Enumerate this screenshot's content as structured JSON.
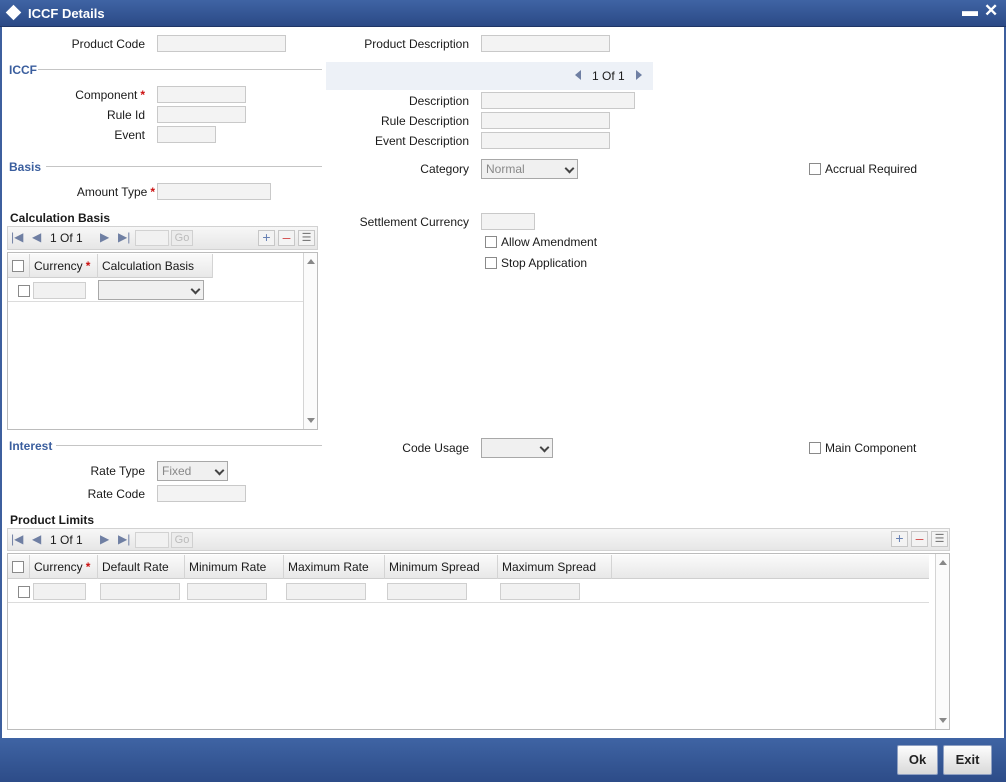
{
  "window": {
    "title": "ICCF Details"
  },
  "header": {
    "product_code_label": "Product Code",
    "product_description_label": "Product Description"
  },
  "iccf": {
    "section_title": "ICCF",
    "component_label": "Component",
    "rule_id_label": "Rule Id",
    "event_label": "Event",
    "pager": {
      "current": "1",
      "of_label": "Of",
      "total": "1"
    },
    "description_label": "Description",
    "rule_description_label": "Rule Description",
    "event_description_label": "Event Description"
  },
  "basis": {
    "section_title": "Basis",
    "amount_type_label": "Amount Type",
    "category_label": "Category",
    "category_value": "Normal",
    "accrual_required_label": "Accrual Required",
    "settlement_currency_label": "Settlement Currency",
    "allow_amendment_label": "Allow Amendment",
    "stop_application_label": "Stop Application"
  },
  "calculation_basis": {
    "title": "Calculation Basis",
    "pager": {
      "current": "1",
      "of_label": "Of",
      "total": "1",
      "go_label": "Go"
    },
    "columns": [
      "Currency",
      "Calculation Basis"
    ]
  },
  "interest": {
    "section_title": "Interest",
    "code_usage_label": "Code Usage",
    "main_component_label": "Main Component",
    "rate_type_label": "Rate Type",
    "rate_type_value": "Fixed",
    "rate_code_label": "Rate Code"
  },
  "product_limits": {
    "title": "Product Limits",
    "pager": {
      "current": "1",
      "of_label": "Of",
      "total": "1",
      "go_label": "Go"
    },
    "columns": [
      "Currency",
      "Default Rate",
      "Minimum Rate",
      "Maximum Rate",
      "Minimum Spread",
      "Maximum Spread"
    ]
  },
  "footer": {
    "ok_label": "Ok",
    "exit_label": "Exit"
  },
  "colors": {
    "titlebar": "#2b4a86",
    "section": "#3a5e9e",
    "required": "#cc1111"
  },
  "icons": {
    "window_icon": "diamond-icon",
    "minimize": "minimize-icon",
    "close": "close-icon",
    "add_row": "plus-icon",
    "delete_row": "minus-icon",
    "single_view": "list-icon"
  }
}
